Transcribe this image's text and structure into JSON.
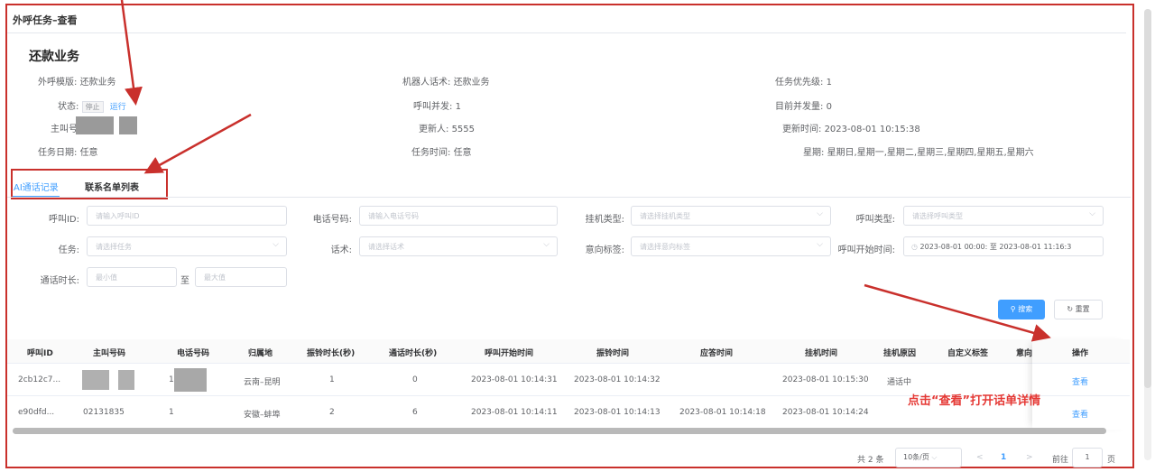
{
  "window": {
    "title": "外呼任务–查看"
  },
  "business_title": "还款业务",
  "info": {
    "template_label": "外呼模版:",
    "template_value": "还款业务",
    "robot_label": "机器人话术:",
    "robot_value": "还款业务",
    "priority_label": "任务优先级:",
    "priority_value": "1",
    "status_label": "状态:",
    "status_stop": "停止",
    "status_run": "运行",
    "concurrency_label": "呼叫并发:",
    "concurrency_value": "1",
    "current_label": "目前并发量:",
    "current_value": "0",
    "caller_label": "主叫号",
    "caller_suffix": "",
    "updater_label": "更新人:",
    "updater_value": "5555",
    "update_time_label": "更新时间:",
    "update_time_value": "2023-08-01 10:15:38",
    "task_date_label": "任务日期:",
    "task_date_value": "任意",
    "task_time_label": "任务时间:",
    "task_time_value": "任意",
    "weekday_label": "星期:",
    "weekday_value": "星期日,星期一,星期二,星期三,星期四,星期五,星期六"
  },
  "tabs": [
    {
      "label": "AI通话记录",
      "active": true
    },
    {
      "label": "联系名单列表",
      "active": false
    }
  ],
  "filters": {
    "call_id": {
      "label": "呼叫ID:",
      "placeholder": "请输入呼叫ID"
    },
    "phone": {
      "label": "电话号码:",
      "placeholder": "请输入电话号码"
    },
    "hangup_type": {
      "label": "挂机类型:",
      "placeholder": "请选择挂机类型"
    },
    "call_type": {
      "label": "呼叫类型:",
      "placeholder": "请选择呼叫类型"
    },
    "task": {
      "label": "任务:",
      "placeholder": "请选择任务"
    },
    "script": {
      "label": "话术:",
      "placeholder": "请选择话术"
    },
    "intent": {
      "label": "意向标签:",
      "placeholder": "请选择意向标签"
    },
    "start_time": {
      "label": "呼叫开始时间:",
      "from": "2023-08-01 00:00:",
      "sep": "至",
      "to": "2023-08-01 11:16:3"
    },
    "duration": {
      "label": "通话时长:",
      "min": "最小值",
      "sep": "至",
      "max": "最大值"
    }
  },
  "buttons": {
    "search": "搜索",
    "reset": "重置"
  },
  "table": {
    "headers": [
      "呼叫ID",
      "主叫号码",
      "电话号码",
      "归属地",
      "振铃时长(秒)",
      "通话时长(秒)",
      "呼叫开始时间",
      "振铃时间",
      "应答时间",
      "挂机时间",
      "挂机原因",
      "自定义标签",
      "意向",
      "操作"
    ],
    "rows": [
      {
        "call_id": "2cb12c7...",
        "caller": "",
        "phone": "1",
        "location": "云南–昆明",
        "ring": "1",
        "talk": "0",
        "start": "2023-08-01 10:14:31",
        "ring_time": "2023-08-01 10:14:32",
        "answer": "",
        "hangup": "2023-08-01 10:15:30",
        "reason": "通话中",
        "custom": "",
        "action": "查看"
      },
      {
        "call_id": "e90dfd...",
        "caller": "02131835",
        "phone": "1",
        "location": "安徽–蚌埠",
        "ring": "2",
        "talk": "6",
        "start": "2023-08-01 10:14:11",
        "ring_time": "2023-08-01 10:14:13",
        "answer": "2023-08-01 10:14:18",
        "hangup": "2023-08-01 10:14:24",
        "reason": "",
        "custom": "",
        "action": "查看"
      }
    ]
  },
  "pagination": {
    "total": "共 2 条",
    "page_size": "10条/页",
    "prev": "<",
    "current": "1",
    "next": ">",
    "goto_label": "前往",
    "goto_value": "1",
    "page_suffix": "页"
  },
  "annotation": "点击“查看”打开话单详情",
  "colors": {
    "accent": "#409eff",
    "annotation_red": "#e53935",
    "frame_red": "#c9302c"
  }
}
